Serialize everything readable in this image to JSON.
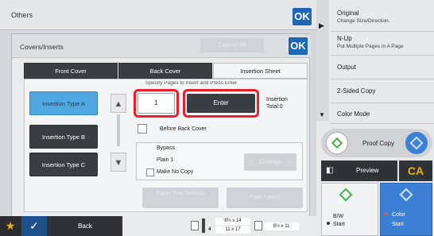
{
  "others": {
    "title": "Others",
    "ok": "OK"
  },
  "dialog": {
    "title": "Covers/Inserts",
    "ok": "OK",
    "cancel_all": "Cancel All",
    "tabs": [
      "Front Cover",
      "Back Cover",
      "Insertion Sheet"
    ],
    "clipped_text": "Specify Pages to Insert and Press Enter",
    "types": [
      "Insertion Type A",
      "Insertion Type B",
      "Insertion Type C"
    ],
    "page_value": "1",
    "enter": "Enter",
    "insertion_label": "Insertion",
    "total": "Total:0",
    "before_back_cover": "Before Back Cover",
    "bypass": "Bypass",
    "plain": "Plain 1",
    "make_no_copy": "Make No Copy",
    "change": "Change",
    "paper_tray_settings": "Paper Tray Settings",
    "page_layout": "Page Layout"
  },
  "sidebar": {
    "original": "Original",
    "original_sub": "Change Size/Direction.",
    "nup": "N-Up",
    "nup_sub": "Put Multiple Pages in A Page",
    "output": "Output",
    "two_sided": "2-Sided Copy",
    "color_mode": "Color Mode",
    "proof_copy": "Proof Copy",
    "preview": "Preview",
    "ca": "CA",
    "bw": "B/W",
    "start": "Start",
    "color": "Color",
    "start2": "Start"
  },
  "bottom": {
    "back": "Back",
    "paper1": "8½ x 14",
    "paper2": "11 x 17",
    "paper3": "8½ x 11",
    "tray_num": "4"
  }
}
